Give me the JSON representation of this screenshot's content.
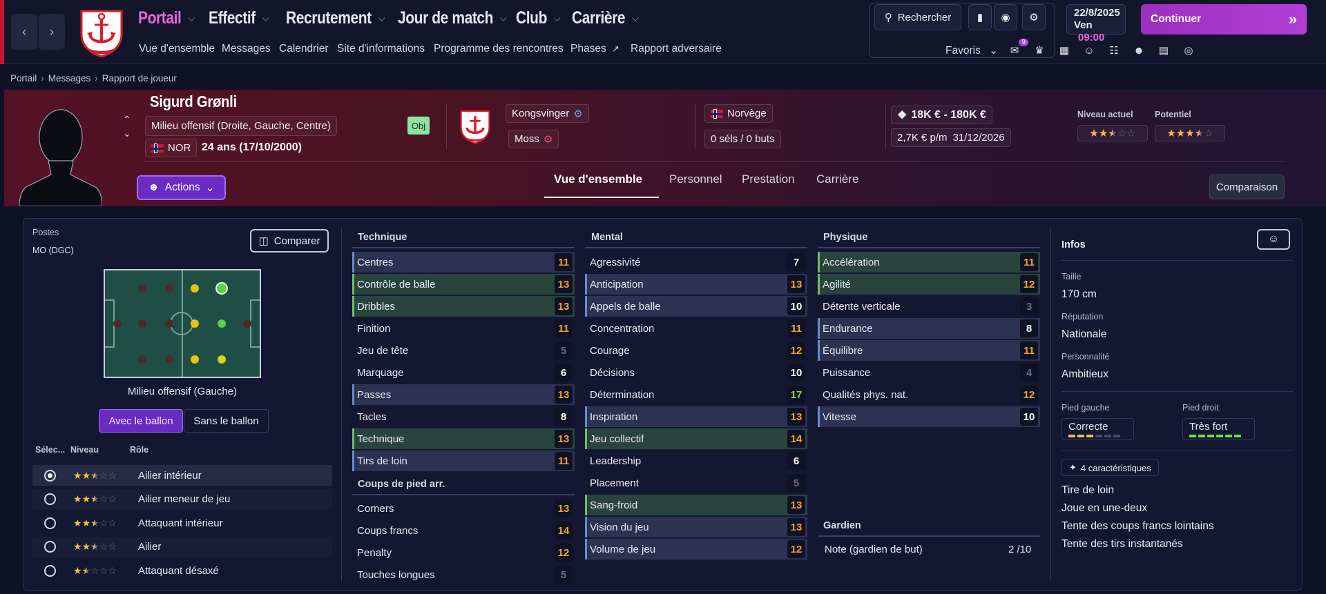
{
  "colors": {
    "accent_pink": "#e86ad8",
    "continue_purple": "#b33fd6",
    "value_orange": "#f5a623",
    "value_green": "#8dd64a",
    "star": "#f5c04a"
  },
  "nav": {
    "menus": [
      {
        "label": "Portail",
        "active": true
      },
      {
        "label": "Effectif"
      },
      {
        "label": "Recrutement"
      },
      {
        "label": "Jour de match"
      },
      {
        "label": "Club"
      },
      {
        "label": "Carrière"
      }
    ],
    "sublinks": [
      "Vue d'ensemble",
      "Messages",
      "Calendrier",
      "Site d'informations",
      "Programme des rencontres",
      "Phases",
      "Rapport adversaire"
    ],
    "search_label": "Rechercher",
    "date": "22/8/2025",
    "day": "Ven",
    "time": "09:00",
    "continue_label": "Continuer",
    "favoris_label": "Favoris",
    "notif_count": "9"
  },
  "breadcrumb": [
    "Portail",
    "Messages",
    "Rapport de joueur"
  ],
  "player": {
    "name": "Sigurd Grønli",
    "position": "Milieu offensif (Droite, Gauche, Centre)",
    "nationality_code": "NOR",
    "age": "24 ans (17/10/2000)",
    "obj_badge": "Obj",
    "club": "Kongsvinger",
    "loan_club": "Moss",
    "nation": "Norvège",
    "caps": "0 séls / 0 buts",
    "value": "18K € - 180K €",
    "wage": "2,7K € p/m",
    "contract_end": "31/12/2026",
    "current_level_label": "Niveau actuel",
    "potential_label": "Potentiel",
    "current_level_stars": 2.5,
    "potential_stars": 3.5,
    "actions_label": "Actions"
  },
  "tabs": [
    "Vue d'ensemble",
    "Personnel",
    "Prestation",
    "Carrière"
  ],
  "compare_top_label": "Comparaison",
  "positions": {
    "title": "Postes",
    "value": "MO (DGC)",
    "compare_label": "Comparer",
    "pitch_caption": "Milieu offensif (Gauche)",
    "toggle_on": "Avec le ballon",
    "toggle_off": "Sans le ballon",
    "roles_headers": [
      "Sélec...",
      "Niveau",
      "Rôle"
    ],
    "roles": [
      {
        "name": "Ailier intérieur",
        "stars": 2.5,
        "selected": true
      },
      {
        "name": "Ailier meneur de jeu",
        "stars": 2.5,
        "selected": false
      },
      {
        "name": "Attaquant intérieur",
        "stars": 2.5,
        "selected": false
      },
      {
        "name": "Ailier",
        "stars": 2.5,
        "selected": false
      },
      {
        "name": "Attaquant désaxé",
        "stars": 1.5,
        "selected": false
      }
    ]
  },
  "technique": {
    "title": "Technique",
    "attrs": [
      {
        "name": "Centres",
        "value": 11,
        "hl": "b",
        "c": "o"
      },
      {
        "name": "Contrôle de balle",
        "value": 13,
        "hl": "gr",
        "c": "o"
      },
      {
        "name": "Dribbles",
        "value": 13,
        "hl": "gr",
        "c": "o"
      },
      {
        "name": "Finition",
        "value": 11,
        "hl": "d",
        "c": "o"
      },
      {
        "name": "Jeu de tête",
        "value": 5,
        "hl": "d",
        "c": "g"
      },
      {
        "name": "Marquage",
        "value": 6,
        "hl": "d",
        "c": "w"
      },
      {
        "name": "Passes",
        "value": 13,
        "hl": "b",
        "c": "o"
      },
      {
        "name": "Tacles",
        "value": 8,
        "hl": "d",
        "c": "w"
      },
      {
        "name": "Technique",
        "value": 13,
        "hl": "gr",
        "c": "o"
      },
      {
        "name": "Tirs de loin",
        "value": 11,
        "hl": "b",
        "c": "o"
      }
    ]
  },
  "set_pieces": {
    "title": "Coups de pied arr.",
    "attrs": [
      {
        "name": "Corners",
        "value": 13,
        "hl": "d",
        "c": "o"
      },
      {
        "name": "Coups francs",
        "value": 14,
        "hl": "d",
        "c": "o"
      },
      {
        "name": "Penalty",
        "value": 12,
        "hl": "d",
        "c": "o"
      },
      {
        "name": "Touches longues",
        "value": 5,
        "hl": "d",
        "c": "g"
      }
    ]
  },
  "mental": {
    "title": "Mental",
    "attrs": [
      {
        "name": "Agressivité",
        "value": 7,
        "hl": "d",
        "c": "w"
      },
      {
        "name": "Anticipation",
        "value": 13,
        "hl": "b",
        "c": "o"
      },
      {
        "name": "Appels de balle",
        "value": 10,
        "hl": "b",
        "c": "w"
      },
      {
        "name": "Concentration",
        "value": 11,
        "hl": "d",
        "c": "o"
      },
      {
        "name": "Courage",
        "value": 12,
        "hl": "d",
        "c": "o"
      },
      {
        "name": "Décisions",
        "value": 10,
        "hl": "d",
        "c": "w"
      },
      {
        "name": "Détermination",
        "value": 17,
        "hl": "d",
        "c": "lg"
      },
      {
        "name": "Inspiration",
        "value": 13,
        "hl": "b",
        "c": "o"
      },
      {
        "name": "Jeu collectif",
        "value": 14,
        "hl": "gr",
        "c": "o"
      },
      {
        "name": "Leadership",
        "value": 6,
        "hl": "d",
        "c": "w"
      },
      {
        "name": "Placement",
        "value": 5,
        "hl": "d",
        "c": "g"
      },
      {
        "name": "Sang-froid",
        "value": 13,
        "hl": "gr",
        "c": "o"
      },
      {
        "name": "Vision du jeu",
        "value": 13,
        "hl": "b",
        "c": "o"
      },
      {
        "name": "Volume de jeu",
        "value": 12,
        "hl": "b",
        "c": "o"
      }
    ]
  },
  "physique": {
    "title": "Physique",
    "attrs": [
      {
        "name": "Accélération",
        "value": 11,
        "hl": "gr",
        "c": "o"
      },
      {
        "name": "Agilité",
        "value": 12,
        "hl": "gr",
        "c": "o"
      },
      {
        "name": "Détente verticale",
        "value": 3,
        "hl": "d",
        "c": "g"
      },
      {
        "name": "Endurance",
        "value": 8,
        "hl": "b",
        "c": "w"
      },
      {
        "name": "Équilibre",
        "value": 11,
        "hl": "b",
        "c": "o"
      },
      {
        "name": "Puissance",
        "value": 4,
        "hl": "d",
        "c": "g"
      },
      {
        "name": "Qualités phys. nat.",
        "value": 12,
        "hl": "d",
        "c": "o"
      },
      {
        "name": "Vitesse",
        "value": 10,
        "hl": "b",
        "c": "w"
      }
    ]
  },
  "goalkeeper": {
    "title": "Gardien",
    "label": "Note (gardien de but)",
    "value": "2 /10"
  },
  "infos": {
    "title": "Infos",
    "height_label": "Taille",
    "height": "170 cm",
    "reputation_label": "Réputation",
    "reputation": "Nationale",
    "personality_label": "Personnalité",
    "personality": "Ambitieux",
    "left_foot_label": "Pied gauche",
    "left_foot": "Correcte",
    "left_foot_level": 3,
    "right_foot_label": "Pied droit",
    "right_foot": "Très fort",
    "right_foot_level": 6,
    "traits_label": "4 caractéristiques",
    "traits": [
      "Tire de loin",
      "Joue en une-deux",
      "Tente des coups francs lointains",
      "Tente des tirs instantanés"
    ]
  }
}
